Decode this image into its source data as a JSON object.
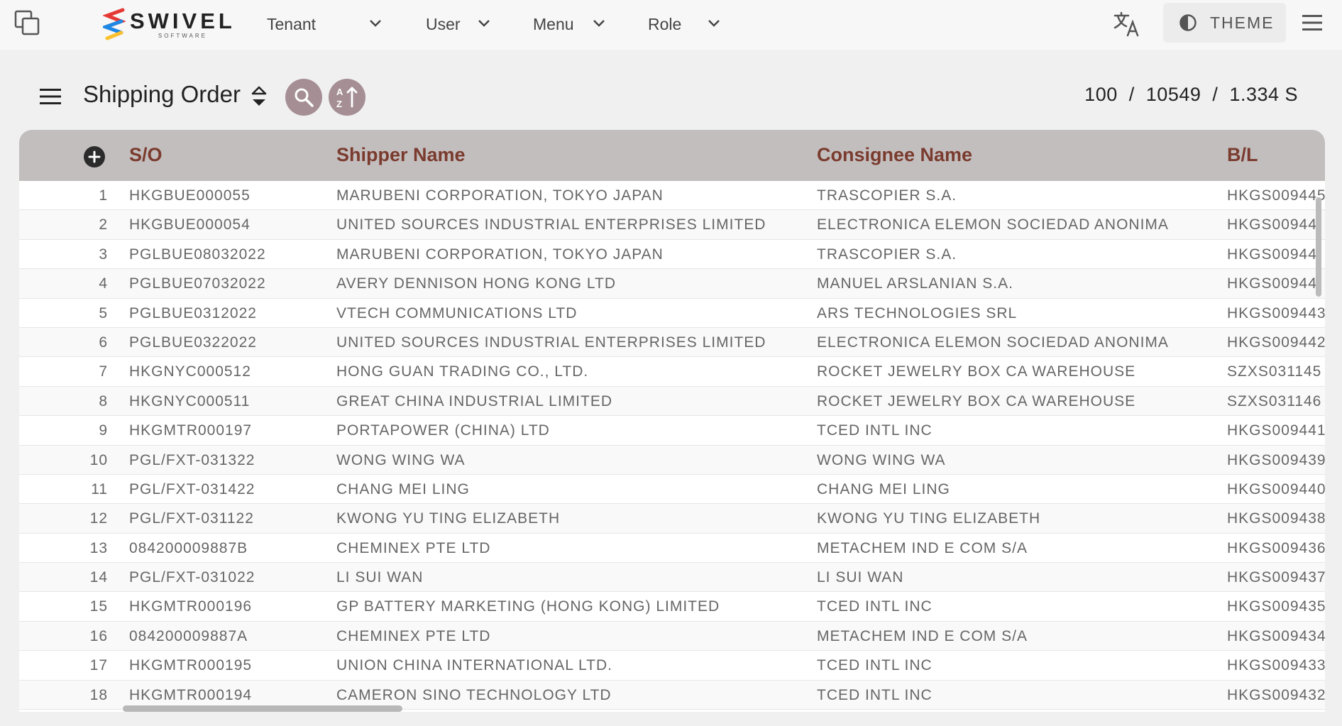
{
  "topbar": {
    "logo_text": "SWIVEL",
    "logo_sub": "SOFTWARE",
    "nav": [
      {
        "label": "Tenant"
      },
      {
        "label": "User"
      },
      {
        "label": "Menu"
      },
      {
        "label": "Role"
      }
    ],
    "theme_label": "THEME",
    "icons": [
      "window-icon",
      "translate-icon",
      "contrast-icon",
      "menu-icon"
    ]
  },
  "page": {
    "title": "Shipping Order",
    "stats": {
      "shown": "100",
      "total": "10549",
      "time": "1.334 S",
      "sep": "/"
    }
  },
  "table": {
    "columns": [
      "S/O",
      "Shipper Name",
      "Consignee Name",
      "B/L"
    ],
    "rows": [
      {
        "n": "1",
        "so": "HKGBUE000055",
        "shipper": "MARUBENI CORPORATION, TOKYO JAPAN",
        "consignee": "TRASCOPIER S.A.",
        "bl": "HKGS009445"
      },
      {
        "n": "2",
        "so": "HKGBUE000054",
        "shipper": "UNITED SOURCES INDUSTRIAL ENTERPRISES LIMITED",
        "consignee": "ELECTRONICA ELEMON SOCIEDAD ANONIMA",
        "bl": "HKGS00944"
      },
      {
        "n": "3",
        "so": "PGLBUE08032022",
        "shipper": "MARUBENI CORPORATION, TOKYO JAPAN",
        "consignee": "TRASCOPIER S.A.",
        "bl": "HKGS00944"
      },
      {
        "n": "4",
        "so": "PGLBUE07032022",
        "shipper": "AVERY DENNISON HONG KONG LTD",
        "consignee": "MANUEL ARSLANIAN S.A.",
        "bl": "HKGS00944"
      },
      {
        "n": "5",
        "so": "PGLBUE0312022",
        "shipper": "VTECH COMMUNICATIONS LTD",
        "consignee": "ARS TECHNOLOGIES SRL",
        "bl": "HKGS009443"
      },
      {
        "n": "6",
        "so": "PGLBUE0322022",
        "shipper": "UNITED SOURCES INDUSTRIAL ENTERPRISES LIMITED",
        "consignee": "ELECTRONICA ELEMON SOCIEDAD ANONIMA",
        "bl": "HKGS009442"
      },
      {
        "n": "7",
        "so": "HKGNYC000512",
        "shipper": "HONG GUAN TRADING CO., LTD.",
        "consignee": "ROCKET JEWELRY BOX CA WAREHOUSE",
        "bl": "SZXS031145"
      },
      {
        "n": "8",
        "so": "HKGNYC000511",
        "shipper": "GREAT CHINA INDUSTRIAL LIMITED",
        "consignee": "ROCKET JEWELRY BOX CA WAREHOUSE",
        "bl": "SZXS031146"
      },
      {
        "n": "9",
        "so": "HKGMTR000197",
        "shipper": "PORTAPOWER (CHINA) LTD",
        "consignee": "TCED INTL INC",
        "bl": "HKGS009441"
      },
      {
        "n": "10",
        "so": "PGL/FXT-031322",
        "shipper": "WONG WING WA",
        "consignee": "WONG WING WA",
        "bl": "HKGS009439"
      },
      {
        "n": "11",
        "so": "PGL/FXT-031422",
        "shipper": "CHANG MEI LING",
        "consignee": "CHANG MEI LING",
        "bl": "HKGS009440"
      },
      {
        "n": "12",
        "so": "PGL/FXT-031122",
        "shipper": "KWONG YU TING ELIZABETH",
        "consignee": "KWONG YU TING ELIZABETH",
        "bl": "HKGS009438"
      },
      {
        "n": "13",
        "so": "084200009887B",
        "shipper": "CHEMINEX PTE LTD",
        "consignee": "METACHEM IND E COM S/A",
        "bl": "HKGS009436"
      },
      {
        "n": "14",
        "so": "PGL/FXT-031022",
        "shipper": "LI SUI WAN",
        "consignee": "LI SUI WAN",
        "bl": "HKGS009437"
      },
      {
        "n": "15",
        "so": "HKGMTR000196",
        "shipper": "GP BATTERY MARKETING (HONG KONG) LIMITED",
        "consignee": "TCED INTL INC",
        "bl": "HKGS009435"
      },
      {
        "n": "16",
        "so": "084200009887A",
        "shipper": "CHEMINEX PTE LTD",
        "consignee": "METACHEM IND E COM S/A",
        "bl": "HKGS009434"
      },
      {
        "n": "17",
        "so": "HKGMTR000195",
        "shipper": "UNION CHINA INTERNATIONAL LTD.",
        "consignee": "TCED INTL INC",
        "bl": "HKGS009433"
      },
      {
        "n": "18",
        "so": "HKGMTR000194",
        "shipper": "CAMERON SINO TECHNOLOGY LTD",
        "consignee": "TCED INTL INC",
        "bl": "HKGS009432"
      }
    ]
  },
  "colors": {
    "header_bg": "#c3bebe",
    "header_text": "#7a3b2e",
    "action_button": "#a58f95"
  }
}
